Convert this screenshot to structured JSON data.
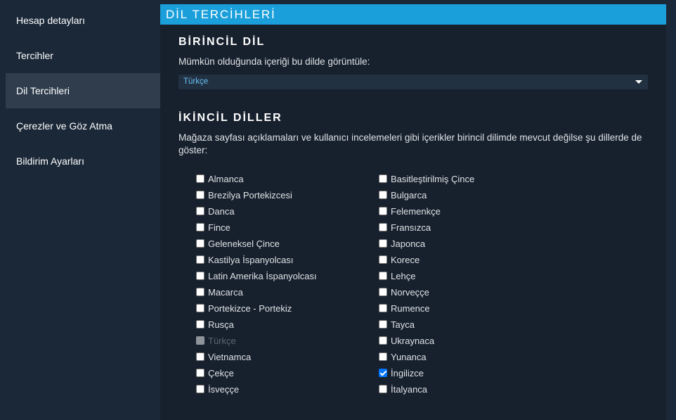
{
  "sidebar": {
    "items": [
      {
        "label": "Hesap detayları",
        "active": false
      },
      {
        "label": "Tercihler",
        "active": false
      },
      {
        "label": "Dil Tercihleri",
        "active": true
      },
      {
        "label": "Çerezler ve Göz Atma",
        "active": false
      },
      {
        "label": "Bildirim Ayarları",
        "active": false
      }
    ]
  },
  "panel": {
    "header": "DİL TERCİHLERİ"
  },
  "primary": {
    "title": "BİRİNCİL DİL",
    "description": "Mümkün olduğunda içeriği bu dilde görüntüle:",
    "selected": "Türkçe"
  },
  "secondary": {
    "title": "İKİNCİL DİLLER",
    "description": "Mağaza sayfası açıklamaları ve kullanıcı incelemeleri gibi içerikler birincil dilimde mevcut değilse şu dillerde de göster:",
    "left_column": [
      {
        "label": "Almanca",
        "checked": false,
        "disabled": false
      },
      {
        "label": "Brezilya Portekizcesi",
        "checked": false,
        "disabled": false
      },
      {
        "label": "Danca",
        "checked": false,
        "disabled": false
      },
      {
        "label": "Fince",
        "checked": false,
        "disabled": false
      },
      {
        "label": "Geleneksel Çince",
        "checked": false,
        "disabled": false
      },
      {
        "label": "Kastilya İspanyolcası",
        "checked": false,
        "disabled": false
      },
      {
        "label": "Latin Amerika İspanyolcası",
        "checked": false,
        "disabled": false
      },
      {
        "label": "Macarca",
        "checked": false,
        "disabled": false
      },
      {
        "label": "Portekizce - Portekiz",
        "checked": false,
        "disabled": false
      },
      {
        "label": "Rusça",
        "checked": false,
        "disabled": false
      },
      {
        "label": "Türkçe",
        "checked": false,
        "disabled": true
      },
      {
        "label": "Vietnamca",
        "checked": false,
        "disabled": false
      },
      {
        "label": "Çekçe",
        "checked": false,
        "disabled": false
      },
      {
        "label": "İsveççe",
        "checked": false,
        "disabled": false
      }
    ],
    "right_column": [
      {
        "label": "Basitleştirilmiş Çince",
        "checked": false,
        "disabled": false
      },
      {
        "label": "Bulgarca",
        "checked": false,
        "disabled": false
      },
      {
        "label": "Felemenkçe",
        "checked": false,
        "disabled": false
      },
      {
        "label": "Fransızca",
        "checked": false,
        "disabled": false
      },
      {
        "label": "Japonca",
        "checked": false,
        "disabled": false
      },
      {
        "label": "Korece",
        "checked": false,
        "disabled": false
      },
      {
        "label": "Lehçe",
        "checked": false,
        "disabled": false
      },
      {
        "label": "Norveççe",
        "checked": false,
        "disabled": false
      },
      {
        "label": "Rumence",
        "checked": false,
        "disabled": false
      },
      {
        "label": "Tayca",
        "checked": false,
        "disabled": false
      },
      {
        "label": "Ukraynaca",
        "checked": false,
        "disabled": false
      },
      {
        "label": "Yunanca",
        "checked": false,
        "disabled": false
      },
      {
        "label": "İngilizce",
        "checked": true,
        "disabled": false
      },
      {
        "label": "İtalyanca",
        "checked": false,
        "disabled": false
      }
    ]
  },
  "colors": {
    "background": "#1b2838",
    "panel": "#17202d",
    "header_accent": "#1a9fdb",
    "sidebar_active": "#2f3d4d",
    "select_value": "#66c0f4",
    "checkbox_checked": "#0075ff"
  },
  "icons": {
    "dropdown": "chevron-down-icon",
    "checkmark": "checkmark-icon"
  }
}
